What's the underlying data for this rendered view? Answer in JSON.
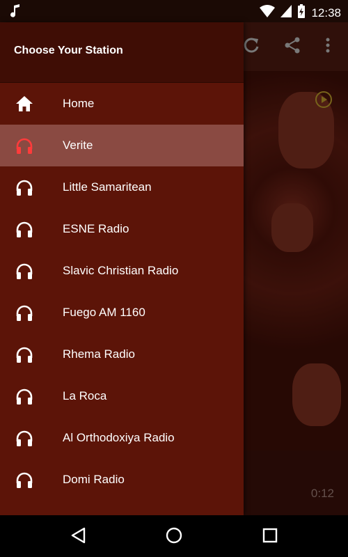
{
  "status_bar": {
    "time": "12:38"
  },
  "drawer": {
    "title": "Choose Your Station",
    "items": [
      {
        "label": "Home",
        "icon": "home-icon"
      },
      {
        "label": "Verite",
        "icon": "headphones-icon",
        "selected": true
      },
      {
        "label": "Little Samaritean",
        "icon": "headphones-icon"
      },
      {
        "label": "ESNE Radio",
        "icon": "headphones-icon"
      },
      {
        "label": "Slavic Christian Radio",
        "icon": "headphones-icon"
      },
      {
        "label": "Fuego AM 1160",
        "icon": "headphones-icon"
      },
      {
        "label": "Rhema Radio",
        "icon": "headphones-icon"
      },
      {
        "label": "La Roca",
        "icon": "headphones-icon"
      },
      {
        "label": "Al Orthodoxiya Radio",
        "icon": "headphones-icon"
      },
      {
        "label": "Domi Radio",
        "icon": "headphones-icon"
      }
    ]
  },
  "player": {
    "elapsed": "0:12"
  },
  "colors": {
    "drawer": "#5c1408",
    "selected": "#8a4a42",
    "header": "#3f0d05"
  }
}
